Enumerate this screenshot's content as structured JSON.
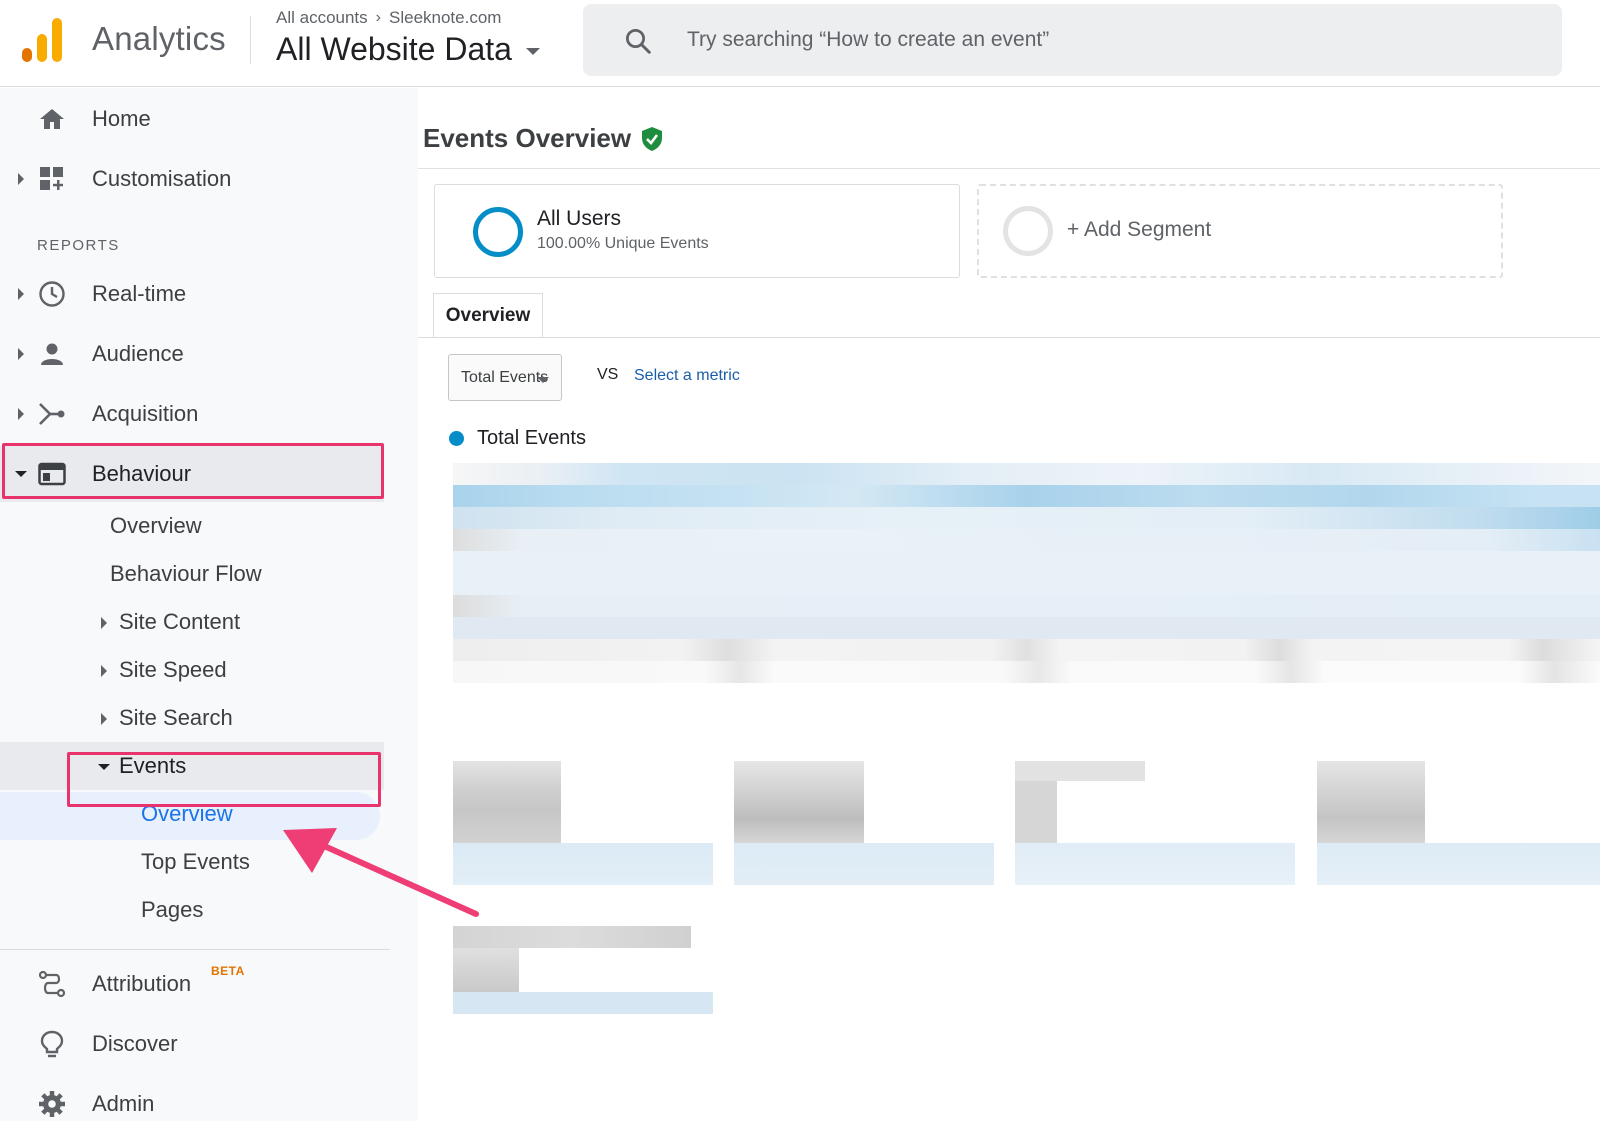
{
  "header": {
    "app_name": "Analytics",
    "account_crumb": "All accounts",
    "property_crumb": "Sleeknote.com",
    "view_name": "All Website Data",
    "search_placeholder": "Try searching “How to create an event”"
  },
  "sidebar": {
    "home": "Home",
    "customisation": "Customisation",
    "reports_heading": "REPORTS",
    "realtime": "Real-time",
    "audience": "Audience",
    "acquisition": "Acquisition",
    "behaviour": "Behaviour",
    "behaviour_sub": {
      "overview": "Overview",
      "behaviour_flow": "Behaviour Flow",
      "site_content": "Site Content",
      "site_speed": "Site Speed",
      "site_search": "Site Search",
      "events": "Events",
      "events_sub": {
        "overview": "Overview",
        "top_events": "Top Events",
        "pages": "Pages"
      }
    },
    "attribution": "Attribution",
    "attribution_badge": "BETA",
    "discover": "Discover",
    "admin": "Admin"
  },
  "main": {
    "page_title": "Events Overview",
    "segment": {
      "title": "All Users",
      "subtitle": "100.00% Unique Events"
    },
    "add_segment": "+ Add Segment",
    "tab": "Overview",
    "metric_select": "Total Events",
    "vs": "VS",
    "select_metric": "Select a metric",
    "legend": "Total Events"
  },
  "colors": {
    "accent_blue": "#058dc7",
    "highlight_pink": "#e8336d",
    "verified_green": "#1e8e3e",
    "link_blue": "#1a5ea8",
    "logo_orange": "#f9ab00",
    "logo_dark_orange": "#e37400"
  }
}
